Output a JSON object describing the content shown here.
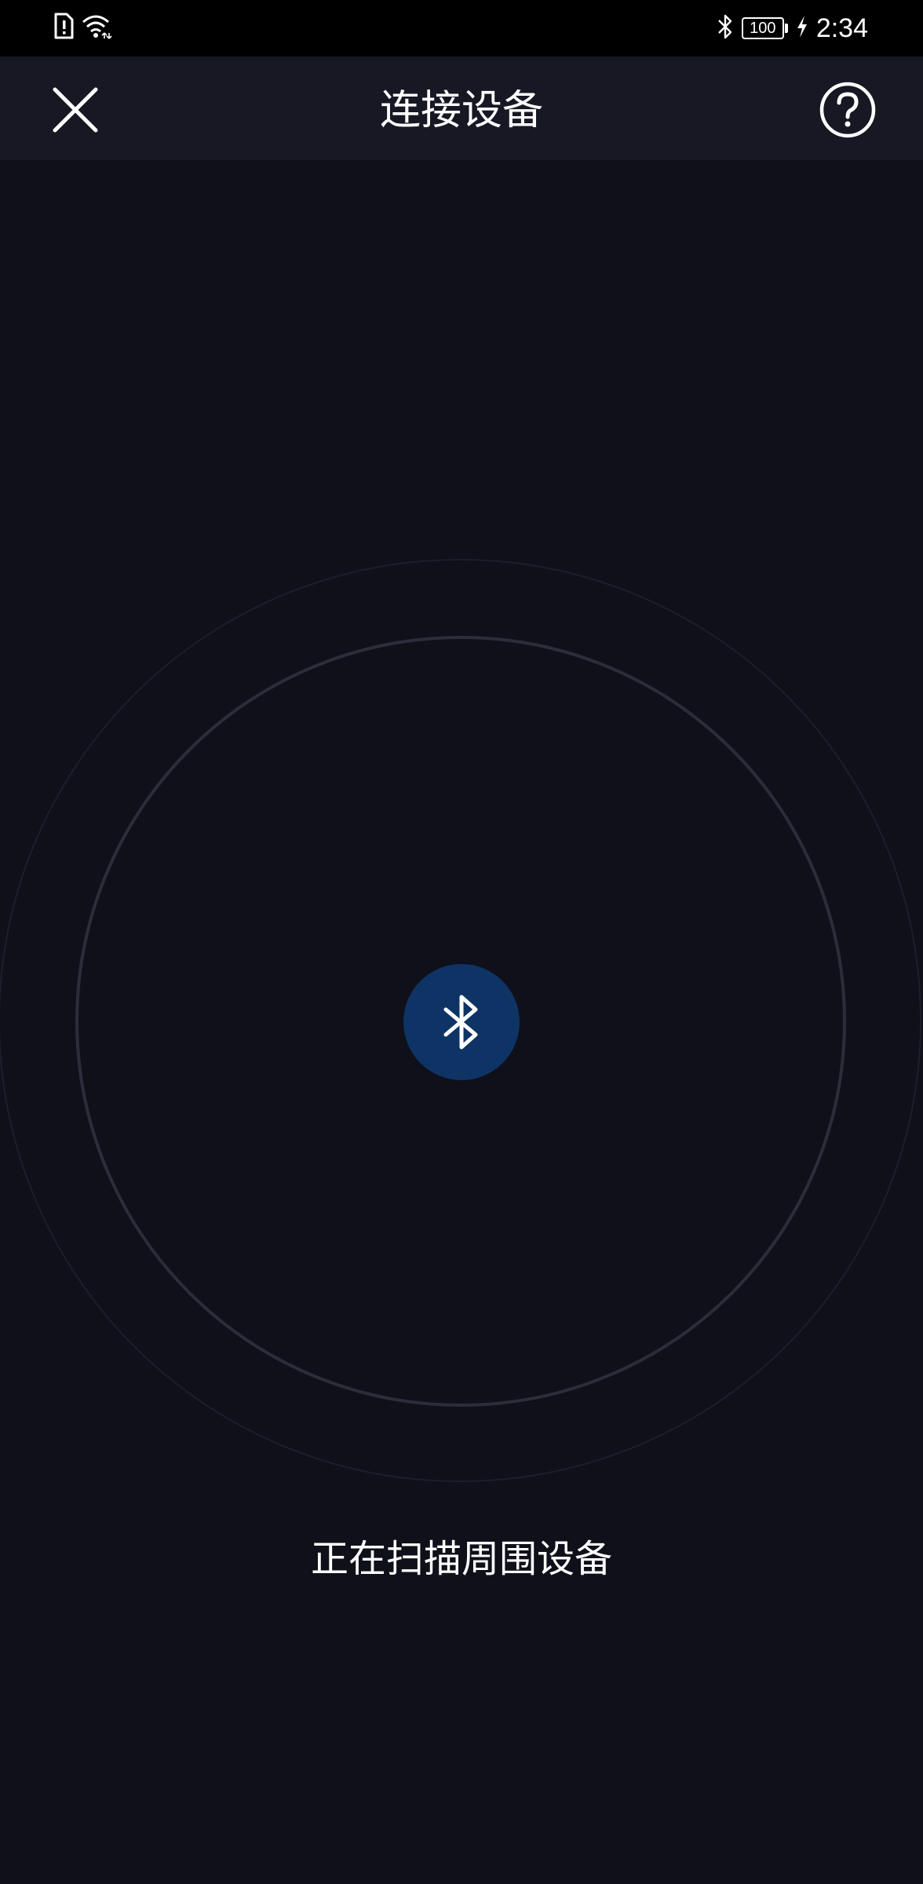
{
  "status_bar": {
    "time": "2:34",
    "battery_level": "100",
    "icons": [
      "sim-alert-icon",
      "wifi-icon",
      "bluetooth-icon",
      "battery-icon",
      "charging-icon"
    ]
  },
  "header": {
    "title": "连接设备",
    "close_icon": "close-icon",
    "help_icon": "help-icon"
  },
  "scanner": {
    "icon": "bluetooth-icon",
    "status_text": "正在扫描周围设备"
  },
  "colors": {
    "background": "#0f1019",
    "header_background": "#171823",
    "bluetooth_circle": "#0e3465",
    "ring": "#2b2d3a"
  }
}
